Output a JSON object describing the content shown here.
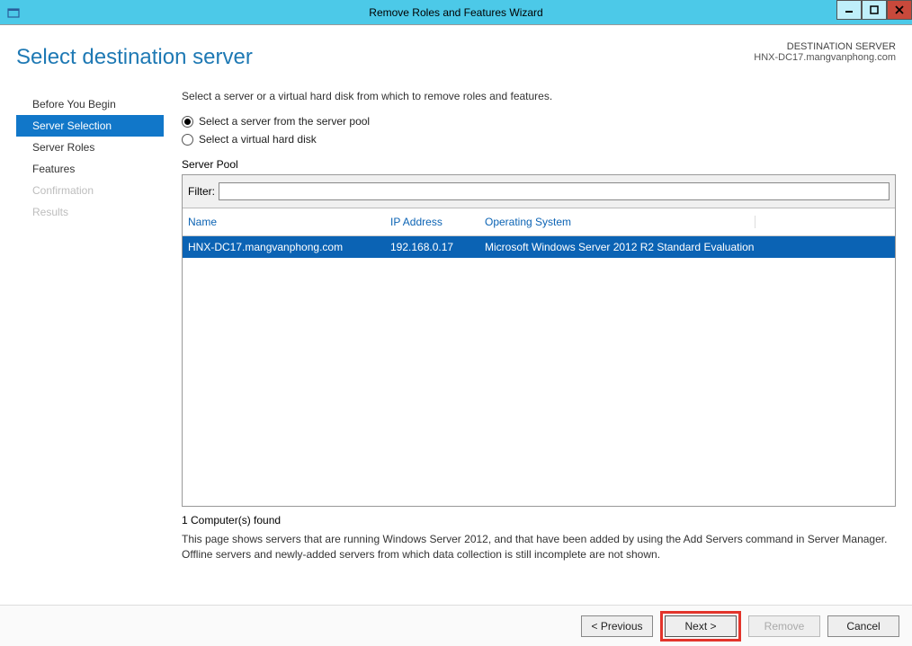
{
  "titlebar": {
    "title": "Remove Roles and Features Wizard"
  },
  "page": {
    "title": "Select destination server"
  },
  "destination": {
    "label": "DESTINATION SERVER",
    "server": "HNX-DC17.mangvanphong.com"
  },
  "sidebar": {
    "items": [
      {
        "label": "Before You Begin",
        "state": "normal"
      },
      {
        "label": "Server Selection",
        "state": "selected"
      },
      {
        "label": "Server Roles",
        "state": "normal"
      },
      {
        "label": "Features",
        "state": "normal"
      },
      {
        "label": "Confirmation",
        "state": "disabled"
      },
      {
        "label": "Results",
        "state": "disabled"
      }
    ]
  },
  "main": {
    "intro": "Select a server or a virtual hard disk from which to remove roles and features.",
    "radio1": "Select a server from the server pool",
    "radio2": "Select a virtual hard disk",
    "pool_label": "Server Pool",
    "filter_label": "Filter:",
    "filter_value": "",
    "columns": {
      "name": "Name",
      "ip": "IP Address",
      "os": "Operating System"
    },
    "rows": [
      {
        "name": "HNX-DC17.mangvanphong.com",
        "ip": "192.168.0.17",
        "os": "Microsoft Windows Server 2012 R2 Standard Evaluation"
      }
    ],
    "found": "1 Computer(s) found",
    "note": "This page shows servers that are running Windows Server 2012, and that have been added by using the Add Servers command in Server Manager. Offline servers and newly-added servers from which data collection is still incomplete are not shown."
  },
  "footer": {
    "previous": "< Previous",
    "next": "Next >",
    "remove": "Remove",
    "cancel": "Cancel"
  }
}
